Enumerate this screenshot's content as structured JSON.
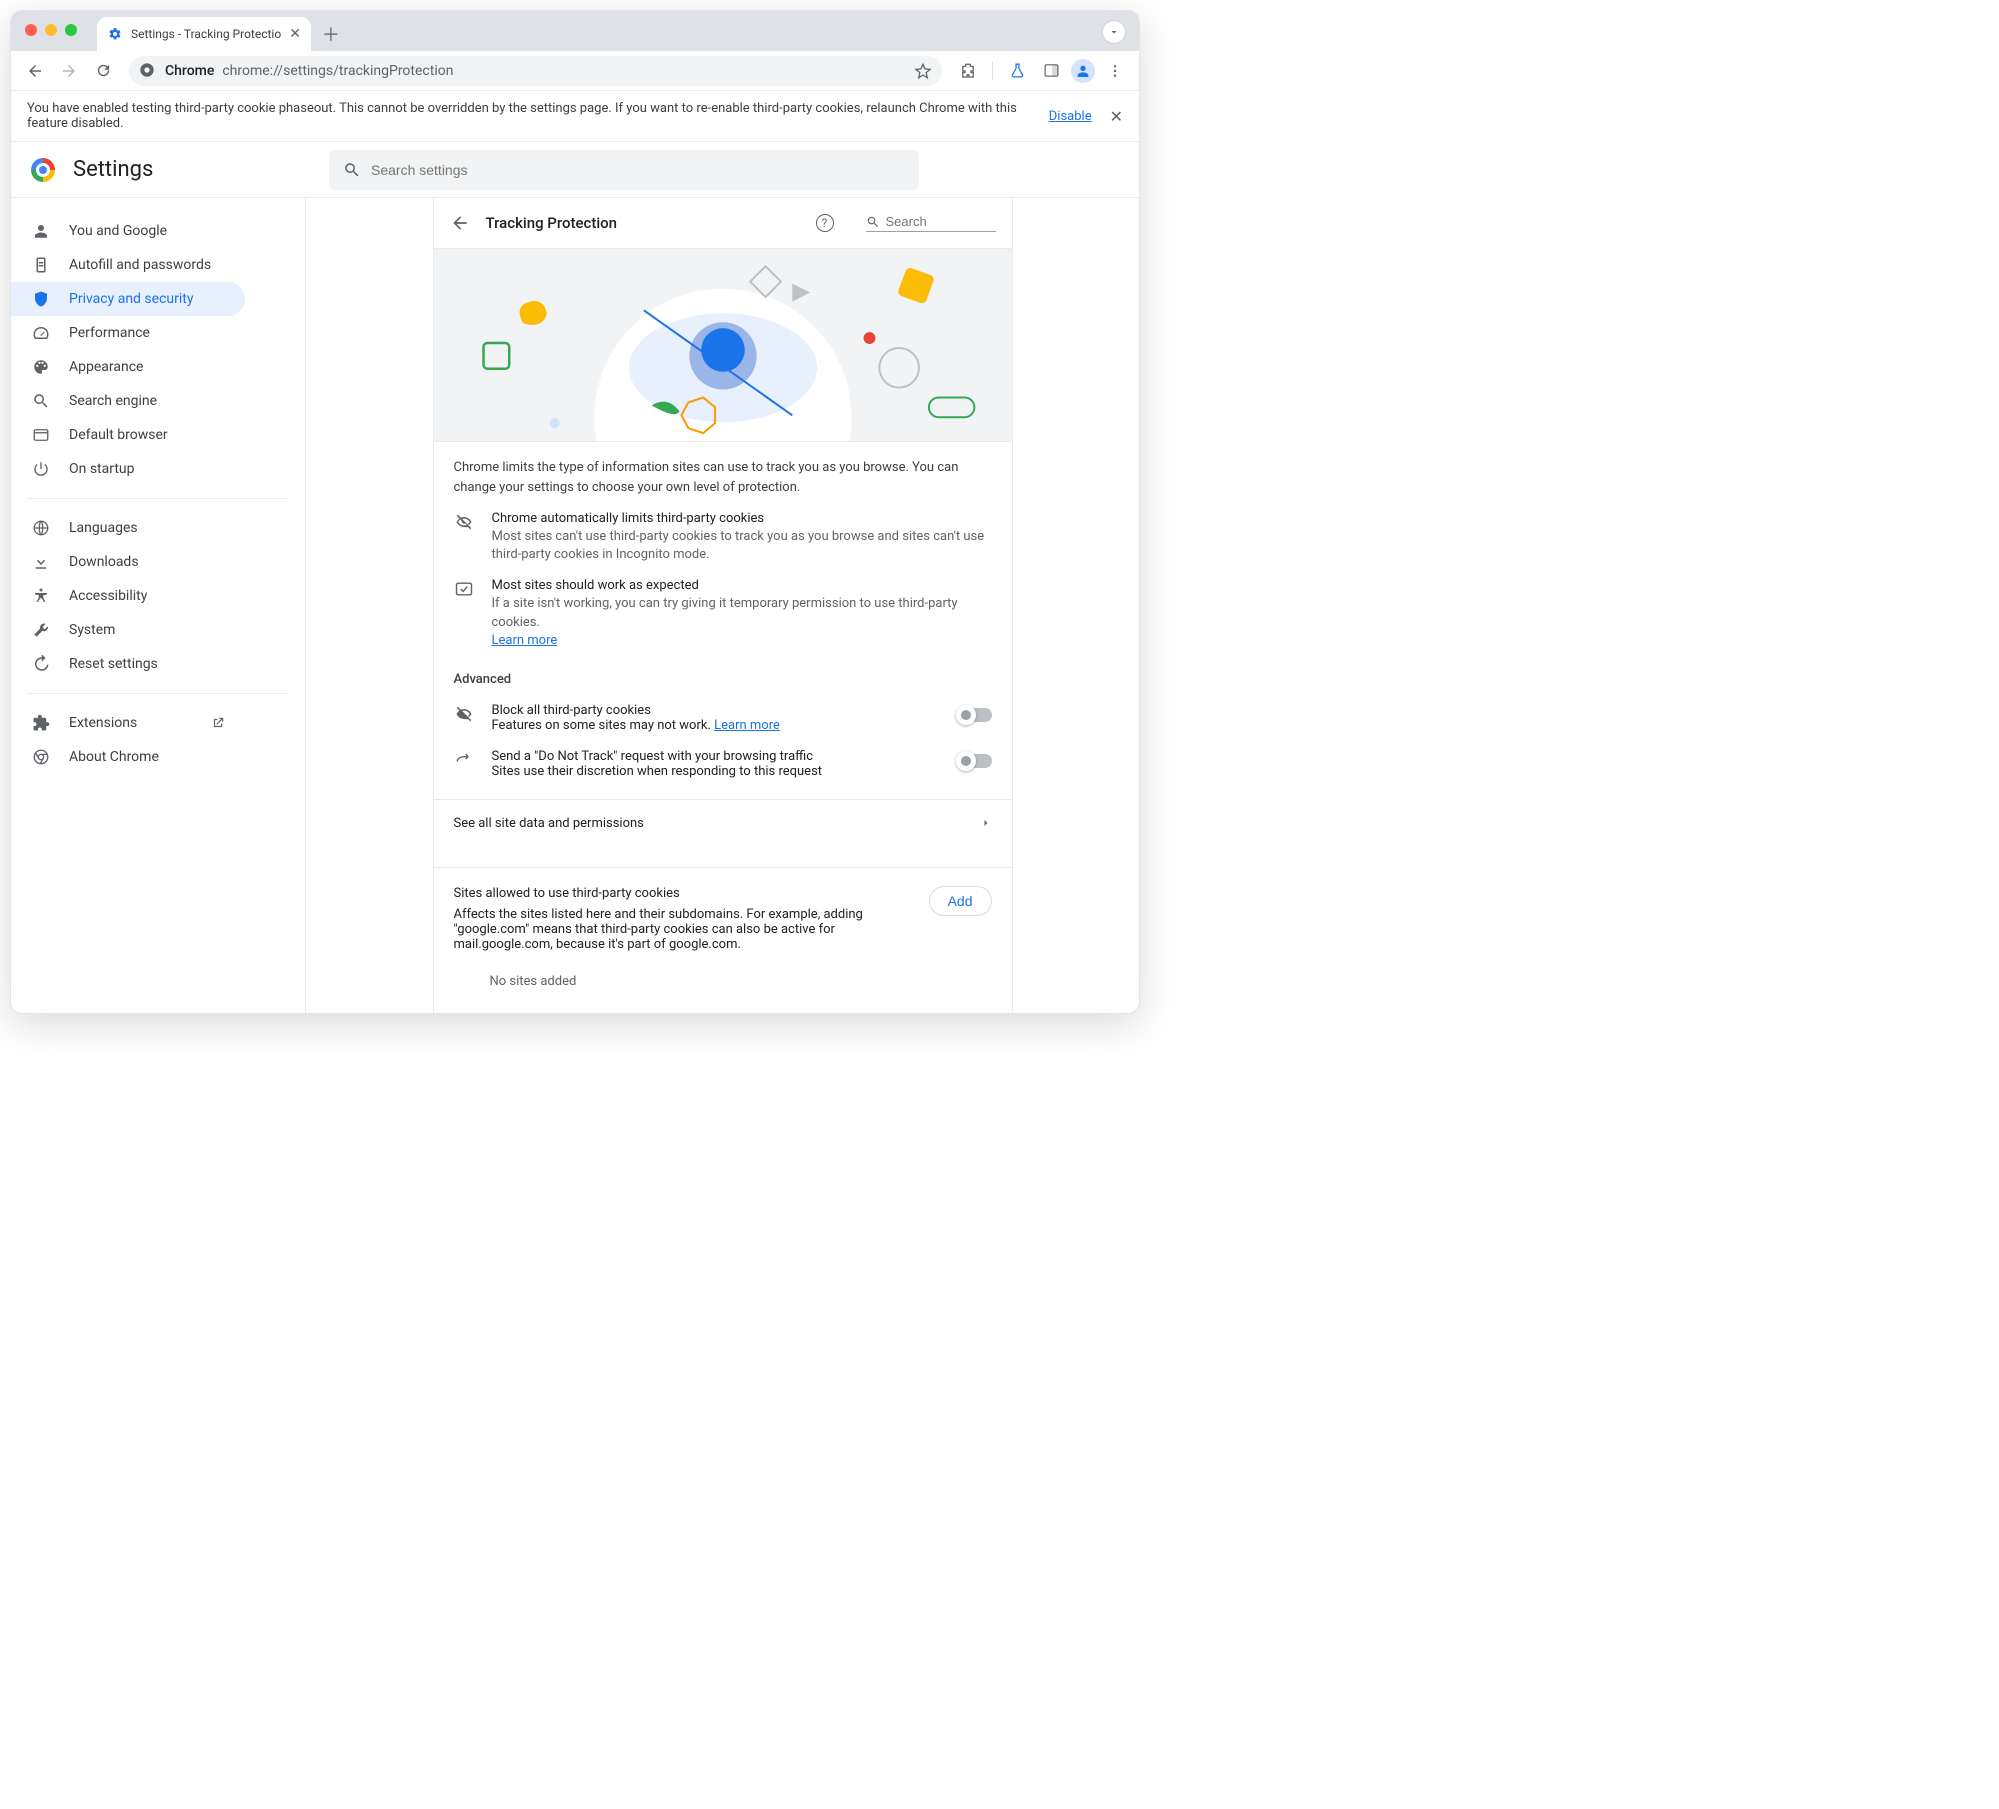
{
  "browser": {
    "tab_title": "Settings - Tracking Protectio",
    "url_site": "Chrome",
    "url_path": "chrome://settings/trackingProtection"
  },
  "infobar": {
    "text": "You have enabled testing third-party cookie phaseout. This cannot be overridden by the settings page. If you want to re-enable third-party cookies, relaunch Chrome with this feature disabled.",
    "disable": "Disable"
  },
  "header": {
    "title": "Settings",
    "search_placeholder": "Search settings"
  },
  "sidebar": {
    "items": [
      {
        "label": "You and Google"
      },
      {
        "label": "Autofill and passwords"
      },
      {
        "label": "Privacy and security"
      },
      {
        "label": "Performance"
      },
      {
        "label": "Appearance"
      },
      {
        "label": "Search engine"
      },
      {
        "label": "Default browser"
      },
      {
        "label": "On startup"
      }
    ],
    "items2": [
      {
        "label": "Languages"
      },
      {
        "label": "Downloads"
      },
      {
        "label": "Accessibility"
      },
      {
        "label": "System"
      },
      {
        "label": "Reset settings"
      }
    ],
    "items3": [
      {
        "label": "Extensions"
      },
      {
        "label": "About Chrome"
      }
    ]
  },
  "panel": {
    "title": "Tracking Protection",
    "search_placeholder": "Search",
    "intro": "Chrome limits the type of information sites can use to track you as you browse. You can change your settings to choose your own level of protection.",
    "bullets": [
      {
        "title": "Chrome automatically limits third-party cookies",
        "sub": "Most sites can't use third-party cookies to track you as you browse and sites can't use third-party cookies in Incognito mode."
      },
      {
        "title": "Most sites should work as expected",
        "sub": "If a site isn't working, you can try giving it temporary permission to use third-party cookies.",
        "learn_more": "Learn more"
      }
    ],
    "advanced": "Advanced",
    "toggles": [
      {
        "title": "Block all third-party cookies",
        "sub": "Features on some sites may not work.",
        "learn_more": "Learn more"
      },
      {
        "title": "Send a \"Do Not Track\" request with your browsing traffic",
        "sub": "Sites use their discretion when responding to this request"
      }
    ],
    "see_all": "See all site data and permissions",
    "allow": {
      "title": "Sites allowed to use third-party cookies",
      "sub": "Affects the sites listed here and their subdomains. For example, adding \"google.com\" means that third-party cookies can also be active for mail.google.com, because it's part of google.com.",
      "add": "Add",
      "empty": "No sites added"
    }
  }
}
